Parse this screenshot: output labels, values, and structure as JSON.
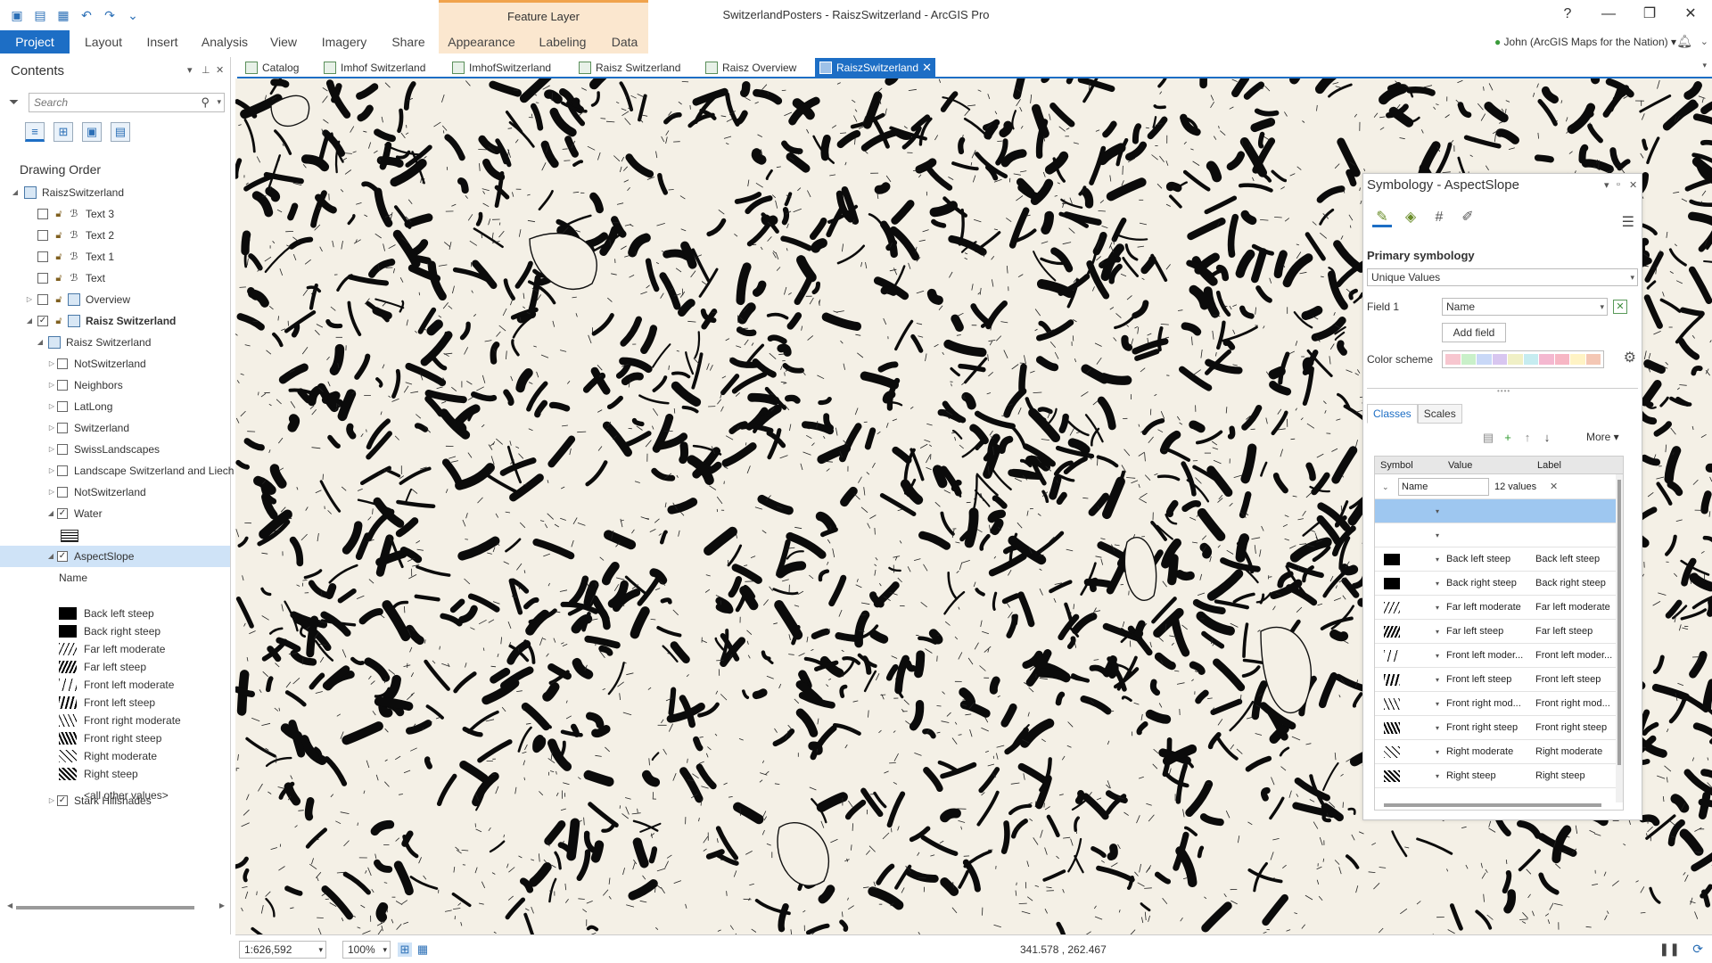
{
  "window": {
    "title": "SwitzerlandPosters - RaiszSwitzerland - ArcGIS Pro",
    "context_label": "Feature Layer",
    "help": "?",
    "minimize": "—",
    "restore": "❐",
    "close": "✕"
  },
  "ribbon": {
    "tabs": [
      "Project",
      "Layout",
      "Insert",
      "Analysis",
      "View",
      "Imagery",
      "Share",
      "Appearance",
      "Labeling",
      "Data"
    ],
    "user": "John (ArcGIS Maps for the Nation)",
    "user_arrow": "▾"
  },
  "doc_tabs": [
    "Catalog",
    "Imhof Switzerland",
    "ImhofSwitzerland",
    "Raisz Switzerland",
    "Raisz Overview",
    "RaiszSwitzerland"
  ],
  "contents": {
    "title": "Contents",
    "search_placeholder": "Search",
    "drawing_order": "Drawing Order",
    "map_name": "RaiszSwitzerland",
    "layers": {
      "text3": "Text 3",
      "text2": "Text 2",
      "text1": "Text 1",
      "text": "Text",
      "overview": "Overview",
      "raisz_group": "Raisz Switzerland",
      "raisz_sub": "Raisz Switzerland",
      "not_switzerland_1": "NotSwitzerland",
      "neighbors": "Neighbors",
      "latlong": "LatLong",
      "switzerland": "Switzerland",
      "swisslandscapes": "SwissLandscapes",
      "landscape": "Landscape Switzerland and Liech",
      "not_switzerland_2": "NotSwitzerland",
      "water": "Water",
      "aspectslope": "AspectSlope",
      "field_name": "Name",
      "stark": "Stark Hillshades"
    },
    "legend": [
      "Back left steep",
      "Back right steep",
      "Far left moderate",
      "Far left steep",
      "Front left moderate",
      "Front left steep",
      "Front right moderate",
      "Front right steep",
      "Right moderate",
      "Right steep"
    ],
    "all_other": "<all other values>"
  },
  "symbology": {
    "title": "Symbology - AspectSlope",
    "primary": "Primary symbology",
    "method": "Unique Values",
    "field1_label": "Field 1",
    "field1_value": "Name",
    "add_field": "Add field",
    "color_scheme_label": "Color scheme",
    "color_scheme": [
      "#f7c6cf",
      "#c9f0c9",
      "#c9d8f7",
      "#d8c6f0",
      "#f0f0c6",
      "#c6ecf0",
      "#f4b8d0",
      "#f7b6c4",
      "#fff3c4",
      "#f4c7b4"
    ],
    "tabs": [
      "Classes",
      "Scales"
    ],
    "more": "More ▾",
    "columns": [
      "Symbol",
      "Value",
      "Label"
    ],
    "group_field": "Name",
    "group_count": "12 values",
    "rows": [
      {
        "value": "Back left steep",
        "label": "Back left steep"
      },
      {
        "value": "Back right steep",
        "label": "Back right steep"
      },
      {
        "value": "Far left moderate",
        "label": "Far left moderate"
      },
      {
        "value": "Far left steep",
        "label": "Far left steep"
      },
      {
        "value": "Front left moder...",
        "label": "Front left moder..."
      },
      {
        "value": "Front left steep",
        "label": "Front left steep"
      },
      {
        "value": "Front right mod...",
        "label": "Front right mod..."
      },
      {
        "value": "Front right steep",
        "label": "Front right steep"
      },
      {
        "value": "Right moderate",
        "label": "Right moderate"
      },
      {
        "value": "Right steep",
        "label": "Right steep"
      }
    ]
  },
  "statusbar": {
    "scale": "1:626,592",
    "zoom": "100%",
    "coords": "341.578 , 262.467"
  },
  "colors": {
    "accent": "#1d6ec5",
    "context": "#fbe7cf",
    "map_bg": "#f4f0e6"
  }
}
